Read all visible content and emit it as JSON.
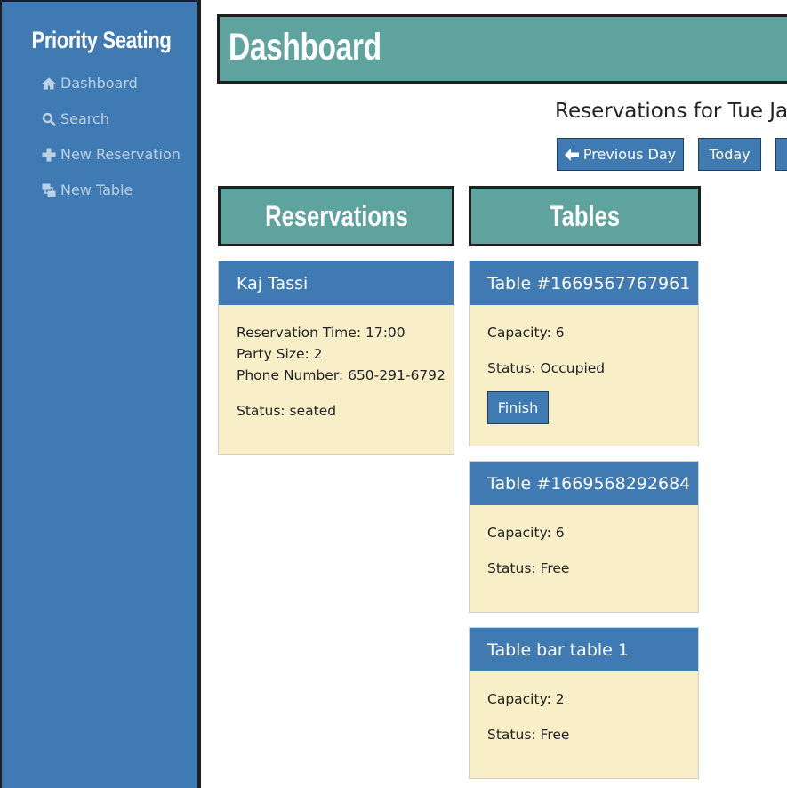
{
  "sidebar": {
    "brand": "Priority Seating",
    "items": [
      {
        "label": "Dashboard",
        "icon": "home-icon"
      },
      {
        "label": "Search",
        "icon": "search-icon"
      },
      {
        "label": "New Reservation",
        "icon": "plus-icon"
      },
      {
        "label": "New Table",
        "icon": "table-icon"
      }
    ]
  },
  "header": {
    "title": "Dashboard",
    "date_heading": "Reservations for Tue Jan",
    "buttons": {
      "previous": "Previous Day",
      "today": "Today"
    }
  },
  "sections": {
    "reservations": "Reservations",
    "tables": "Tables"
  },
  "reservations": [
    {
      "name": "Kaj Tassi",
      "time": "Reservation Time: 17:00",
      "party": "Party Size: 2",
      "phone": "Phone Number: 650-291-6792",
      "status": "Status: seated"
    }
  ],
  "tables": [
    {
      "name": "Table #1669567767961",
      "capacity": "Capacity: 6",
      "status": "Status: Occupied",
      "action": "Finish"
    },
    {
      "name": "Table #1669568292684",
      "capacity": "Capacity: 6",
      "status": "Status: Free"
    },
    {
      "name": "Table bar table 1",
      "capacity": "Capacity: 2",
      "status": "Status: Free"
    }
  ],
  "colors": {
    "sidebar": "#3f7ab3",
    "banner": "#5fa39f",
    "card_body": "#f8efc8"
  }
}
